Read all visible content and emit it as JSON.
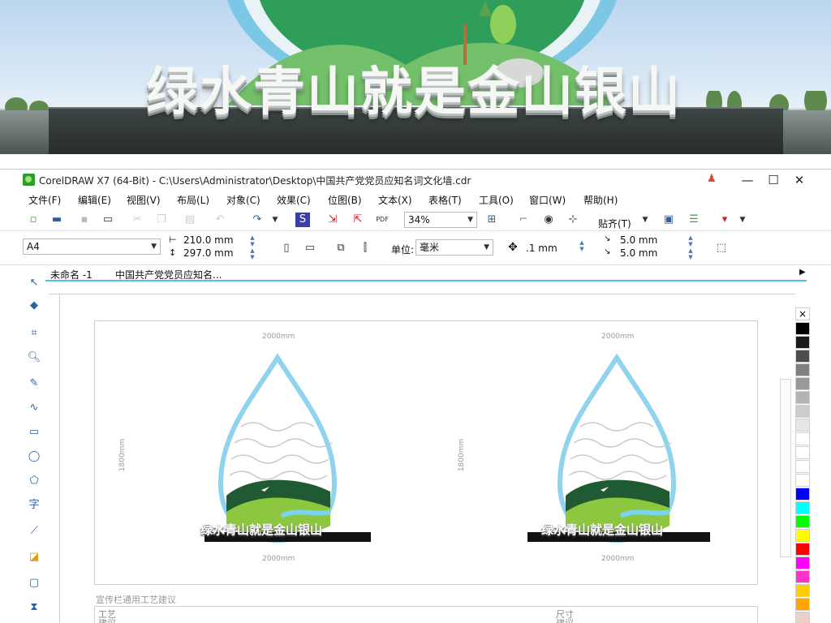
{
  "banner": {
    "slogan": "绿水青山就是金山银山"
  },
  "window": {
    "title": "CorelDRAW X7 (64-Bit) - C:\\Users\\Administrator\\Desktop\\中国共产党党员应知名词文化墙.cdr",
    "minimize": "—",
    "maximize": "☐",
    "close": "✕"
  },
  "menu": {
    "items": [
      "文件(F)",
      "编辑(E)",
      "视图(V)",
      "布局(L)",
      "对象(C)",
      "效果(C)",
      "位图(B)",
      "文本(X)",
      "表格(T)",
      "工具(O)",
      "窗口(W)",
      "帮助(H)"
    ]
  },
  "toolbar1": {
    "zoom": "34%",
    "snap_label": "贴齐(T)"
  },
  "toolbar2": {
    "page_size": "A4",
    "width": "210.0 mm",
    "height": "297.0 mm",
    "units_label": "单位:",
    "units_value": "毫米",
    "nudge": ".1 mm",
    "dup_x": "5.0 mm",
    "dup_y": "5.0 mm"
  },
  "tabs": {
    "items": [
      "未命名 -1",
      "中国共产党党员应知名..."
    ]
  },
  "drawing": {
    "width_label_top": "2000mm",
    "width_label_bottom": "2000mm",
    "height_label": "1800mm",
    "sign_text": "绿水青山就是金山银山",
    "section_title": "宣传栏通用工艺建议",
    "craft_label_1": "工艺建议",
    "craft_label_2": "尺寸建议"
  },
  "palette": {
    "colors": [
      "#000000",
      "#1a1a1a",
      "#4d4d4d",
      "#808080",
      "#999999",
      "#b3b3b3",
      "#cccccc",
      "#e6e6e6",
      "#ffffff",
      "#ffffff",
      "#ffffff",
      "#ffffff",
      "#0000ff",
      "#00ffff",
      "#00ff00",
      "#ffff00",
      "#ff0000",
      "#ff00ff",
      "#ff33cc",
      "#ffcc00",
      "#ffa500",
      "#e8d2c6"
    ]
  }
}
